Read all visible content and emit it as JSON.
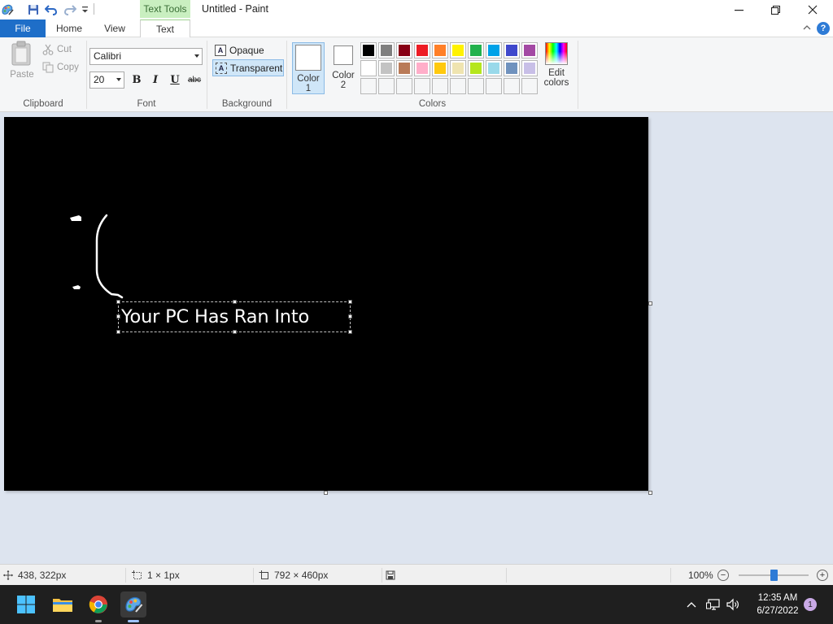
{
  "window": {
    "title": "Untitled - Paint",
    "contextual_tab": "Text Tools"
  },
  "tabs": {
    "file": "File",
    "home": "Home",
    "view": "View",
    "text": "Text"
  },
  "ribbon": {
    "clipboard": {
      "paste": "Paste",
      "cut": "Cut",
      "copy": "Copy",
      "label": "Clipboard"
    },
    "font": {
      "family": "Calibri",
      "size": "20",
      "bold": "B",
      "italic": "I",
      "underline": "U",
      "strikethrough": "abc",
      "label": "Font"
    },
    "background": {
      "opaque": "Opaque",
      "transparent": "Transparent",
      "selected": "transparent",
      "label": "Background"
    },
    "colors": {
      "color1_line1": "Color",
      "color1_line2": "1",
      "color2_line1": "Color",
      "color2_line2": "2",
      "edit_line1": "Edit",
      "edit_line2": "colors",
      "label": "Colors",
      "color1_value": "#ffffff",
      "color2_value": "#ffffff",
      "palette_row1": [
        "#000000",
        "#7f7f7f",
        "#880015",
        "#ed1c24",
        "#ff7f27",
        "#fff200",
        "#22b14c",
        "#00a2e8",
        "#3f48cc",
        "#a349a4"
      ],
      "palette_row2": [
        "#ffffff",
        "#c3c3c3",
        "#b97a57",
        "#ffaec9",
        "#ffc90e",
        "#efe4b0",
        "#b5e61d",
        "#99d9ea",
        "#7092be",
        "#c8bfe7"
      ],
      "palette_row3": [
        "",
        "",
        "",
        "",
        "",
        "",
        "",
        "",
        "",
        ""
      ]
    }
  },
  "canvas": {
    "background": "#000000",
    "text_box": "Your PC Has Ran Into"
  },
  "status": {
    "cursor": "438, 322px",
    "selection": "1 × 1px",
    "canvas_size": "792 × 460px",
    "zoom": "100%",
    "zoom_level": 0.5
  },
  "taskbar": {
    "time": "12:35 AM",
    "date": "6/27/2022",
    "notifications": "1"
  },
  "colors": {
    "accent": "#1e6ec8",
    "text_tools": "#c9efc0"
  }
}
